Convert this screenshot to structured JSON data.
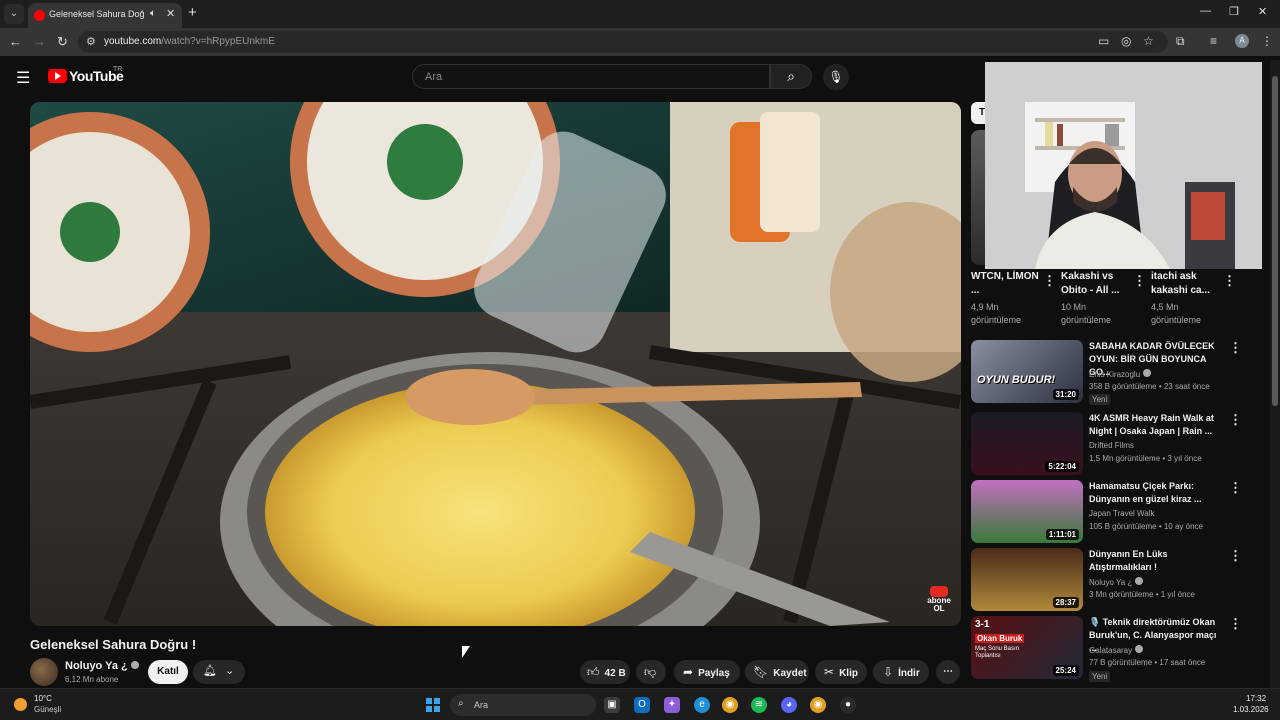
{
  "browser": {
    "tab_title": "Geleneksel Sahura Doğru !",
    "url_host": "youtube.com",
    "url_path": "/watch?v=hRpypEUnkmE",
    "profile_initial": "A"
  },
  "youtube": {
    "logo_text": "YouTube",
    "country_code": "TR",
    "search_placeholder": "Ara"
  },
  "video": {
    "title": "Geleneksel Sahura Doğru !",
    "channel_name": "Noluyo Ya ¿",
    "subscribers": "6,12 Mn abone",
    "join_label": "Katıl",
    "like_count": "42 B",
    "share_label": "Paylaş",
    "save_label": "Kaydet",
    "clip_label": "Klip",
    "download_label": "İndir",
    "watermark_text": "abone\nOL"
  },
  "sidebar": {
    "chip_label": "T",
    "shorts": [
      {
        "title": "WTCN, LİMON ...",
        "views": "4,9 Mn görüntüleme"
      },
      {
        "title": "Kakashi vs Obito - All ...",
        "views": "10 Mn görüntüleme"
      },
      {
        "title": "itachi ask kakashi ca...",
        "views": "4,5 Mn görüntüleme"
      }
    ],
    "videos": [
      {
        "title": "SABAHA KADAR ÖVÜLECEK OYUN: BİR GÜN BOYUNCA GO...",
        "channel": "Enis Kirazoglu",
        "meta": "358 B görüntüleme • 23 saat önce",
        "duration": "31:20",
        "badge": "Yeni",
        "thumb_text": "OYUN BUDUR!"
      },
      {
        "title": "4K ASMR Heavy Rain Walk at Night | Osaka Japan | Rain ...",
        "channel": "Drifted Films",
        "meta": "1,5 Mn görüntüleme • 3 yıl önce",
        "duration": "5:22:04"
      },
      {
        "title": "Hamamatsu Çiçek Parkı: Dünyanın en güzel kiraz ...",
        "channel": "Japan Travel Walk",
        "meta": "105 B görüntüleme • 10 ay önce",
        "duration": "1:11:01"
      },
      {
        "title": "Dünyanın En Lüks Atıştırmalıkları !",
        "channel": "Noluyo Ya ¿",
        "meta": "3 Mn görüntüleme • 1 yıl önce",
        "duration": "28:37"
      },
      {
        "title": "🎙️ Teknik direktörümüz Okan Buruk'un, C. Alanyaspor maçı ...",
        "channel": "Galatasaray",
        "meta": "77 B görüntüleme • 17 saat önce",
        "duration": "25:24",
        "badge": "Yeni",
        "thumb_text_1": "3-1",
        "thumb_text_2": "Okan Buruk",
        "thumb_text_3": "Maç Sonu Basın Toplantısı"
      }
    ]
  },
  "taskbar": {
    "weather_temp": "10°C",
    "weather_desc": "Güneşli",
    "search_text": "Ara",
    "time": "17:32",
    "date": "1.03.2026"
  },
  "colors": {
    "yt_red": "#ff0000",
    "background": "#0f0f0f",
    "chip_bg": "#272727"
  }
}
